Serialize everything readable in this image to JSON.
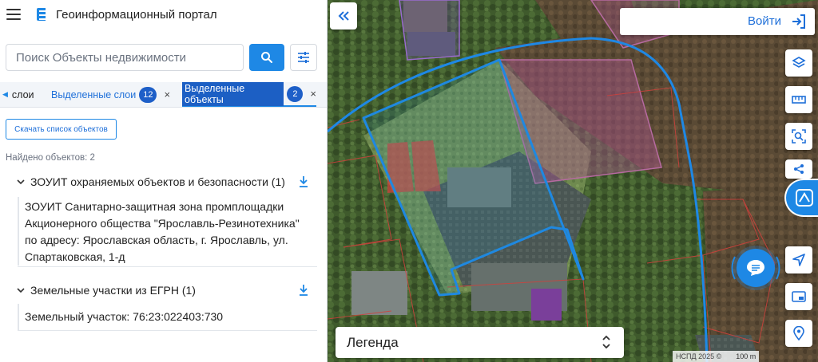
{
  "header": {
    "title": "Геоинформационный портал"
  },
  "search": {
    "placeholder": "Поиск Объекты недвижимости"
  },
  "tabs": {
    "left_label": "слои",
    "selected_layers_label": "Выделенные слои",
    "selected_layers_count": "12",
    "selected_objects_label": "Выделенные объекты",
    "selected_objects_count": "2",
    "close_glyph": "×"
  },
  "results": {
    "download_list_label": "Скачать список объектов",
    "found_text": "Найдено объектов: 2",
    "groups": [
      {
        "title": "ЗОУИТ охраняемых объектов и безопасности (1)",
        "items": [
          "ЗОУИТ Санитарно-защитная зона промплощадки Акционерного общества \"Ярославль-Резинотехника\" по адресу: Ярославская область, г. Ярославль, ул. Спартаковская, 1-д"
        ]
      },
      {
        "title": "Земельные участки из ЕГРН (1)",
        "items": [
          "Земельный участок: 76:23:022403:730"
        ]
      }
    ]
  },
  "map": {
    "login_label": "Войти",
    "legend_label": "Легенда",
    "attribution": "НСПД 2025 ©",
    "scale_label": "100 m",
    "colors": {
      "accent": "#1e88e5",
      "zone_outline": "#1e88e5",
      "parcel_outline": "#c0392b",
      "selection_fill": "#b05a8a"
    },
    "icons": [
      "collapse-icon",
      "login-icon",
      "layers-icon",
      "ruler-icon",
      "select-area-icon",
      "share-icon",
      "nspd-logo-icon",
      "chat-icon",
      "navigate-icon",
      "picture-in-picture-icon",
      "location-pin-icon"
    ]
  }
}
